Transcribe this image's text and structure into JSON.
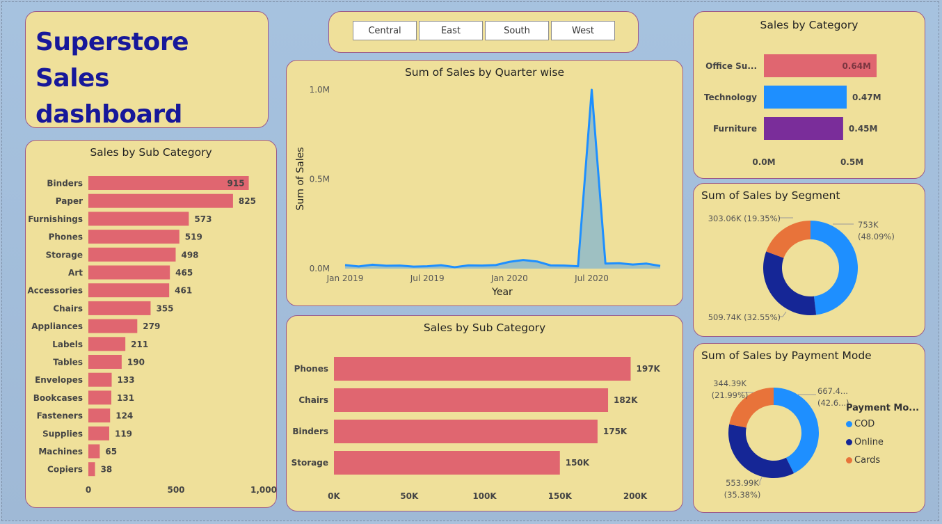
{
  "title": "Superstore Sales dashboard",
  "slicer": [
    "Central",
    "East",
    "South",
    "West"
  ],
  "colors": {
    "bar": "#e06670",
    "line": "#1e8fff",
    "area": "#95bcc6",
    "technology": "#1e8fff",
    "furniture": "#7a2d9a",
    "corporate": "#1e8fff",
    "consumer": "#152696",
    "home_office": "#e8733a"
  },
  "sub_category_left": {
    "title": "Sales by Sub Category",
    "chart_data": {
      "type": "bar",
      "orientation": "horizontal",
      "categories": [
        "Binders",
        "Paper",
        "Furnishings",
        "Phones",
        "Storage",
        "Art",
        "Accessories",
        "Chairs",
        "Appliances",
        "Labels",
        "Tables",
        "Envelopes",
        "Bookcases",
        "Fasteners",
        "Supplies",
        "Machines",
        "Copiers"
      ],
      "values": [
        915,
        825,
        573,
        519,
        498,
        465,
        461,
        355,
        279,
        211,
        190,
        133,
        131,
        124,
        119,
        65,
        38
      ],
      "labels": [
        "915",
        "825",
        "573",
        "519",
        "498",
        "465",
        "461",
        "355",
        "279",
        "211",
        "190",
        "133",
        "131",
        "124",
        "119",
        "65",
        "38"
      ],
      "xlim": [
        0,
        1000
      ],
      "ticks": [
        "0",
        "500",
        "1,000"
      ]
    }
  },
  "quarter_line": {
    "title": "Sum of Sales by Quarter wise",
    "chart_data": {
      "type": "area",
      "x": [
        "Jan 2019",
        "Feb 2019",
        "Mar 2019",
        "Apr 2019",
        "May 2019",
        "Jun 2019",
        "Jul 2019",
        "Aug 2019",
        "Sep 2019",
        "Oct 2019",
        "Nov 2019",
        "Dec 2019",
        "Jan 2020",
        "Feb 2020",
        "Mar 2020",
        "Apr 2020",
        "May 2020",
        "Jun 2020",
        "Jul 2020",
        "Aug 2020",
        "Sep 2020",
        "Oct 2020",
        "Nov 2020",
        "Dec 2020"
      ],
      "values": [
        20000,
        12000,
        22000,
        16000,
        17000,
        11000,
        13000,
        19000,
        8000,
        18000,
        17000,
        20000,
        38000,
        48000,
        40000,
        18000,
        17000,
        13000,
        1000000,
        28000,
        30000,
        23000,
        28000,
        15000
      ],
      "xlabel": "Year",
      "ylabel": "Sum of Sales",
      "ylim": [
        0,
        1000000
      ],
      "yticks": [
        "1.0M",
        "0.5M",
        "0.0M"
      ],
      "xticks": [
        "Jan 2019",
        "Jul 2019",
        "Jan 2020",
        "Jul 2020"
      ]
    }
  },
  "sub_category_bottom": {
    "title": "Sales by Sub Category",
    "chart_data": {
      "type": "bar",
      "orientation": "horizontal",
      "categories": [
        "Phones",
        "Chairs",
        "Binders",
        "Storage"
      ],
      "values": [
        197000,
        182000,
        175000,
        150000
      ],
      "labels": [
        "197K",
        "182K",
        "175K",
        "150K"
      ],
      "xlim": [
        0,
        200000
      ],
      "ticks": [
        "0K",
        "50K",
        "100K",
        "150K",
        "200K"
      ]
    }
  },
  "category": {
    "title": "Sales by Category",
    "chart_data": {
      "type": "bar",
      "orientation": "horizontal",
      "categories": [
        "Office Su...",
        "Technology",
        "Furniture"
      ],
      "values": [
        640000,
        470000,
        450000
      ],
      "labels": [
        "0.64M",
        "0.47M",
        "0.45M"
      ],
      "xlim": [
        0,
        640000
      ],
      "ticks": [
        "0.0M",
        "0.5M"
      ]
    }
  },
  "segment": {
    "title": "Sum of Sales by Segment",
    "chart_data": {
      "type": "pie",
      "donut": true,
      "values": [
        753000,
        509740,
        303060
      ],
      "labels": [
        "753K\n(48.09%)",
        "509.74K (32.55%)",
        "303.06K (19.35%)"
      ]
    }
  },
  "payment": {
    "title": "Sum of Sales by Payment Mode",
    "legend_title": "Payment Mo...",
    "chart_data": {
      "type": "pie",
      "donut": true,
      "series_names": [
        "COD",
        "Online",
        "Cards"
      ],
      "values": [
        667400,
        553990,
        344390
      ],
      "labels": [
        "667.4...\n(42.6...)",
        "553.99K\n(35.38%)",
        "344.39K\n(21.99%)"
      ]
    }
  }
}
